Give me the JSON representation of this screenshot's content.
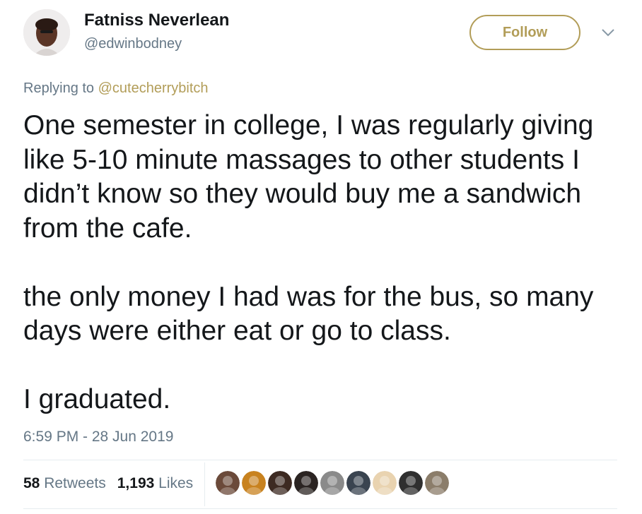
{
  "author": {
    "display_name": "Fatniss Neverlean",
    "handle": "@edwinbodney",
    "avatar_icon": "profile-photo"
  },
  "follow_button": {
    "label": "Follow",
    "color": "#b29d58"
  },
  "menu": {
    "icon": "chevron-down-icon"
  },
  "reply": {
    "prefix": "Replying to",
    "target": "@cutecherrybitch"
  },
  "tweet": {
    "text": "One semester in college, I was regularly giving like 5-10 minute massages to other students I didn’t know so they would buy me a sandwich from the cafe.\n\nthe only money I had was for the bus, so many days were either eat or go to class.\n\nI graduated.",
    "timestamp": "6:59 PM - 28 Jun 2019"
  },
  "stats": {
    "retweets_count": "58",
    "retweets_label": "Retweets",
    "likes_count": "1,193",
    "likes_label": "Likes"
  },
  "likers": [
    {
      "icon": "liker-avatar-1",
      "color": "#6b4a3a"
    },
    {
      "icon": "liker-avatar-2",
      "color": "#c8821f"
    },
    {
      "icon": "liker-avatar-3",
      "color": "#3d2a22"
    },
    {
      "icon": "liker-avatar-4",
      "color": "#2b2422"
    },
    {
      "icon": "liker-avatar-5",
      "color": "#8a8a8a"
    },
    {
      "icon": "liker-avatar-6",
      "color": "#3a4450"
    },
    {
      "icon": "liker-avatar-7",
      "color": "#e9d3b0"
    },
    {
      "icon": "liker-avatar-8",
      "color": "#2f2f2f"
    },
    {
      "icon": "liker-avatar-9",
      "color": "#8b7d6a"
    }
  ],
  "colors": {
    "accent": "#b29d58",
    "text": "#14171a",
    "muted": "#657786",
    "divider": "#e6ecf0"
  }
}
